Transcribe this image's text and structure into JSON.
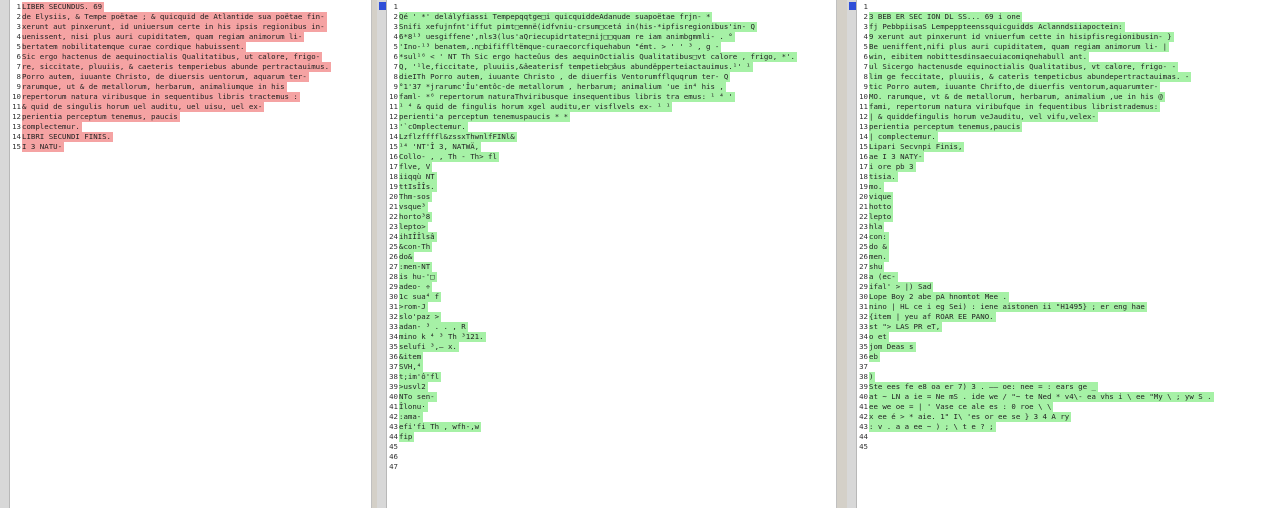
{
  "panes": [
    {
      "name": "left-pane",
      "color": "red",
      "lines": [
        {
          "n": "1",
          "t": "LIBER SECUNDUS. 69"
        },
        {
          "n": "2",
          "t": "de Elysiis, & Tempe poëtae ; & quicquid de Atlantide sua poëtae fin-"
        },
        {
          "n": "3",
          "t": "xerunt aut pinxerunt, id uniuersum certe in his ipsis regionibus in-"
        },
        {
          "n": "4",
          "t": "uenissent, nisi plus auri cupiditatem, quam regiam animorum li-"
        },
        {
          "n": "5",
          "t": "bertatem nobilitatemque curae cordique habuissent."
        },
        {
          "n": "6",
          "t": "  Sic ergo hactenus de aequinoctialis Qualitatibus, ut calore, frigo-"
        },
        {
          "n": "7",
          "t": "re, siccitate, pluuiis, & caeteris temperiebus abunde pertractauimus."
        },
        {
          "n": "8",
          "t": "Porro autem, iuuante Christo, de diuersis uentorum, aquarum ter-"
        },
        {
          "n": "9",
          "t": "rarumque, ut & de metallorum, herbarum, animaliumque in his"
        },
        {
          "n": "10",
          "t": "repertorum natura viribusque in sequentibus libris tractemus :"
        },
        {
          "n": "11",
          "t": "& quid de singulis horum uel auditu, uel uisu, uel ex-"
        },
        {
          "n": "12",
          "t": "perientia perceptum tenemus, paucis"
        },
        {
          "n": "13",
          "t": "complectemur."
        },
        {
          "n": "14",
          "t": "LIBRI SECUNDI FINIS."
        },
        {
          "n": "15",
          "t": "I 3 NATU-"
        }
      ]
    },
    {
      "name": "middle-pane",
      "color": "green",
      "lines": [
        {
          "n": "1",
          "t": ""
        },
        {
          "n": "2",
          "t": "Qé ' *' delályfiassi Tempepqqtge□i quicquiddeAdanude suapoëtae frjn- *"
        },
        {
          "n": "3",
          "t": "Snifi xefujnfnt'iffut pimt□emnë(idfvniu-crsum□cetá in(his-*ipfisregionibus'in- Q"
        },
        {
          "n": "4",
          "t": "6*8¹³ uesgiffene',nls3(lus'aQriecupidrtate□nij□□quam re iam animbgmmli- . °"
        },
        {
          "n": "5",
          "t": "'Ino-¹³ benatem,.n□bififfltëmque-curaecorcfiquehabun \"émt. > ' ' ³ , g -"
        },
        {
          "n": "6",
          "t": "*sul¹⁶ < ' NT Th Sic ergo hacteûus des aequinOctialis Qualitatibus□vt calore , frigo, *'."
        },
        {
          "n": "7",
          "t": "Q, '¹le,ficcitate, pluuiis,&âeaterisf tempetieb□âus abundëpperteiactauimus.¹' ¹"
        },
        {
          "n": "8",
          "t": "dieITh Porro autem, iuuante Christo , de diuerfis Ventorumfflquqrum ter- Q"
        },
        {
          "n": "9",
          "t": "°1'37 *jrarumc'Îu'emtôc-de metallorum , herbarum; animalium 'ue in⁴ his ,"
        },
        {
          "n": "10",
          "t": "faml· *⁶ repertorum naturaThviribusque insequentibus libris tra emus: ¹ ⁴ '"
        },
        {
          "n": "11",
          "t": "¹ ⁴ & quid de fingulis horum xgel auditu,er visflvels ex- ¹ ¹"
        },
        {
          "n": "12",
          "t": "perienti'a perceptum tenemuspaucis * *"
        },
        {
          "n": "13",
          "t": "'`cOmplectemur."
        },
        {
          "n": "14",
          "t": "Lzflzffffl&zssxThwnlfFINl&"
        },
        {
          "n": "15",
          "t": "¹⁴ 'NT'Î 3, NATWÄ,"
        },
        {
          "n": "16",
          "t": "Collo- , , Th - Th> fl"
        },
        {
          "n": "17",
          "t": "flve, V"
        },
        {
          "n": "18",
          "t": "iiqqù NT"
        },
        {
          "n": "19",
          "t": "ttIsÎÎs."
        },
        {
          "n": "20",
          "t": "Thm-sos"
        },
        {
          "n": "21",
          "t": "vsque³"
        },
        {
          "n": "22",
          "t": "horto³8"
        },
        {
          "n": "23",
          "t": "lepto>"
        },
        {
          "n": "24",
          "t": "ihIÎÎlsâ"
        },
        {
          "n": "25",
          "t": "&con-Th"
        },
        {
          "n": "26",
          "t": "do&"
        },
        {
          "n": "27",
          "t": ":men-NT"
        },
        {
          "n": "28",
          "t": "is hu-'□"
        },
        {
          "n": "29",
          "t": "adeo· ÷"
        },
        {
          "n": "30",
          "t": "1c sua⁴ f"
        },
        {
          "n": "31",
          "t": ">rom-J"
        },
        {
          "n": "32",
          "t": "slo'paz >"
        },
        {
          "n": "33",
          "t": "adan- ³ . . , R"
        },
        {
          "n": "34",
          "t": "mino k ⁴ ³ Th ³121."
        },
        {
          "n": "35",
          "t": "selufi ³,— x."
        },
        {
          "n": "36",
          "t": "&item"
        },
        {
          "n": "37",
          "t": "SVH,⁴"
        },
        {
          "n": "38",
          "t": "t;im'ô'fl"
        },
        {
          "n": "39",
          "t": ">usvl2"
        },
        {
          "n": "40",
          "t": "NTo sen-"
        },
        {
          "n": "41",
          "t": "Îlonu·"
        },
        {
          "n": "42",
          "t": ":ama-"
        },
        {
          "n": "43",
          "t": "efi'fi Th , wfh-,w"
        },
        {
          "n": "44",
          "t": "fip"
        },
        {
          "n": "45",
          "t": ""
        },
        {
          "n": "46",
          "t": ""
        },
        {
          "n": "47",
          "t": ""
        }
      ]
    },
    {
      "name": "right-pane",
      "color": "green",
      "lines": [
        {
          "n": "1",
          "t": ""
        },
        {
          "n": "2",
          "t": "  3 BEB ER SEC ION DL SS... 69 i one"
        },
        {
          "n": "3",
          "t": "fj PebbpiisaS Lempeppteenssquicguidds Aclanndsiiapoctein:"
        },
        {
          "n": "4",
          "t": "9 xerunt aut pinxerunt id vniuerfum cette in hisipfisregionibusin- }"
        },
        {
          "n": "5",
          "t": "Be ueniffent,nifi plus auri cupiditatem, quam regiam animorum li- |"
        },
        {
          "n": "6",
          "t": "win, eibitem nobittesdinsaecuiacomiqnehabull ant."
        },
        {
          "n": "7",
          "t": "ul  Sicergo hactenusde equinoctialis Qualitatibus, vt calore, frigo- -"
        },
        {
          "n": "8",
          "t": "lim ge feccitate, pluuiis, & caterìs tempeticbus abundepertractauimas. -"
        },
        {
          "n": "9",
          "t": "tic Porro autem, iuuante Chrifto,de diuerfis ventorum,aquarumter-"
        },
        {
          "n": "10",
          "t": "MO. rarumque, vt & de metallorum, herbarum, animalium ,ue in his @"
        },
        {
          "n": "11",
          "t": "fami, repertorum natura viribufque in fequentibus libristrademus:"
        },
        {
          "n": "12",
          "t": "| & quiddefingulis horum veJauditu, vel vifu,velex-"
        },
        {
          "n": "13",
          "t": "perientia perceptum tenemus,paucis"
        },
        {
          "n": "14",
          "t": "| complectemur."
        },
        {
          "n": "15",
          "t": "Lipari Secvnpi Finis,"
        },
        {
          "n": "16",
          "t": "ae I 3 NATY-"
        },
        {
          "n": "17",
          "t": "i ore pb 3"
        },
        {
          "n": "18",
          "t": "tisia."
        },
        {
          "n": "19",
          "t": "mo."
        },
        {
          "n": "20",
          "t": "vique"
        },
        {
          "n": "21",
          "t": "hotto"
        },
        {
          "n": "22",
          "t": "lepto"
        },
        {
          "n": "23",
          "t": "hla"
        },
        {
          "n": "24",
          "t": "con:"
        },
        {
          "n": "25",
          "t": "do &"
        },
        {
          "n": "26",
          "t": "men."
        },
        {
          "n": "27",
          "t": "shu"
        },
        {
          "n": "28",
          "t": "a (ec-"
        },
        {
          "n": "29",
          "t": "ifal' > |) Sad"
        },
        {
          "n": "30",
          "t": "Lope Boy 2 abe pA hnomtot Mee ."
        },
        {
          "n": "31",
          "t": "nino | HL ce i eg Sei) : iene aistonen ii \"H1495} ; er eng hae"
        },
        {
          "n": "32",
          "t": "{item | yeu af ROAR EE PANO."
        },
        {
          "n": "33",
          "t": "st \"> LAS PR eT,"
        },
        {
          "n": "34",
          "t": "o et"
        },
        {
          "n": "35",
          "t": "jom Deas s"
        },
        {
          "n": "36",
          "t": "eb"
        },
        {
          "n": "37",
          "t": ""
        },
        {
          "n": "38",
          "t": ")"
        },
        {
          "n": "39",
          "t": "Ste ees fe e8 oa er 7) 3 . —— oe: nee = : ears ge _"
        },
        {
          "n": "40",
          "t": "at ~ LN a ie = Ne mS . ide we / \"~ te Ned * v4\\- ea vhs i \\ ee \"My \\ ; yw S ."
        },
        {
          "n": "41",
          "t": "ee we oe = | ' Vase ce ale es : 0 roe \\ \\"
        },
        {
          "n": "42",
          "t": "x ee é > * aie. 1\" I\\ 'es or ee se } 3 4 A ry"
        },
        {
          "n": "43",
          "t": ": v . a a ee ~ ) ; \\ t e ? ;"
        },
        {
          "n": "44",
          "t": ""
        },
        {
          "n": "45",
          "t": ""
        }
      ]
    }
  ]
}
